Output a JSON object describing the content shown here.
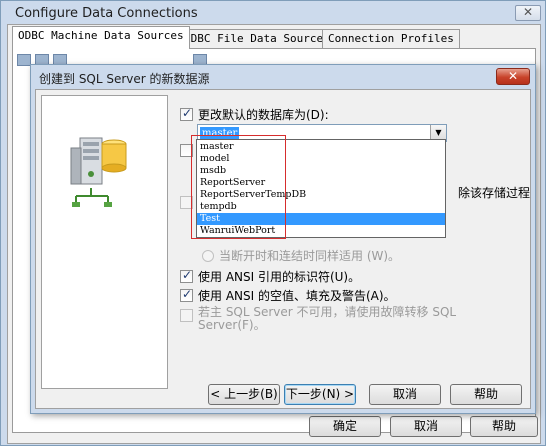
{
  "outer": {
    "title": "Configure Data Connections",
    "close": "✕",
    "tabs": [
      "ODBC Machine Data Sources",
      "ODBC File Data Sources",
      "Connection Profiles"
    ],
    "buttons": {
      "ok": "确定",
      "cancel": "取消",
      "help": "帮助"
    }
  },
  "inner": {
    "title": "创建到 SQL Server 的新数据源",
    "close": "✕",
    "change_db_label": "更改默认的数据库为(D):",
    "combo_value": "master",
    "dropdown_options": [
      "master",
      "model",
      "msdb",
      "ReportServer",
      "ReportServerTempDB",
      "tempdb",
      "Test",
      "WanruiWebPort"
    ],
    "selected_index": 6,
    "partial_right_text": "除该存储过程",
    "radio_label": "当断开时和连结时同样适用 (W)。",
    "ansi_quoted": "使用 ANSI 引用的标识符(U)。",
    "ansi_nulls": "使用 ANSI 的空值、填充及警告(A)。",
    "failover_line1": "若主 SQL Server 不可用，请使用故障转移 SQL",
    "failover_line2": "Server(F)。",
    "buttons": {
      "back": "< 上一步(B)",
      "next": "下一步(N) >",
      "cancel": "取消",
      "help": "帮助"
    }
  },
  "colors": {
    "highlight": "#3399ff",
    "red_box": "#d62d2d",
    "title_bar": "#ccdaec"
  },
  "icons": [
    "server-database-icon",
    "checkbox",
    "radio",
    "dropdown-arrow-icon"
  ]
}
